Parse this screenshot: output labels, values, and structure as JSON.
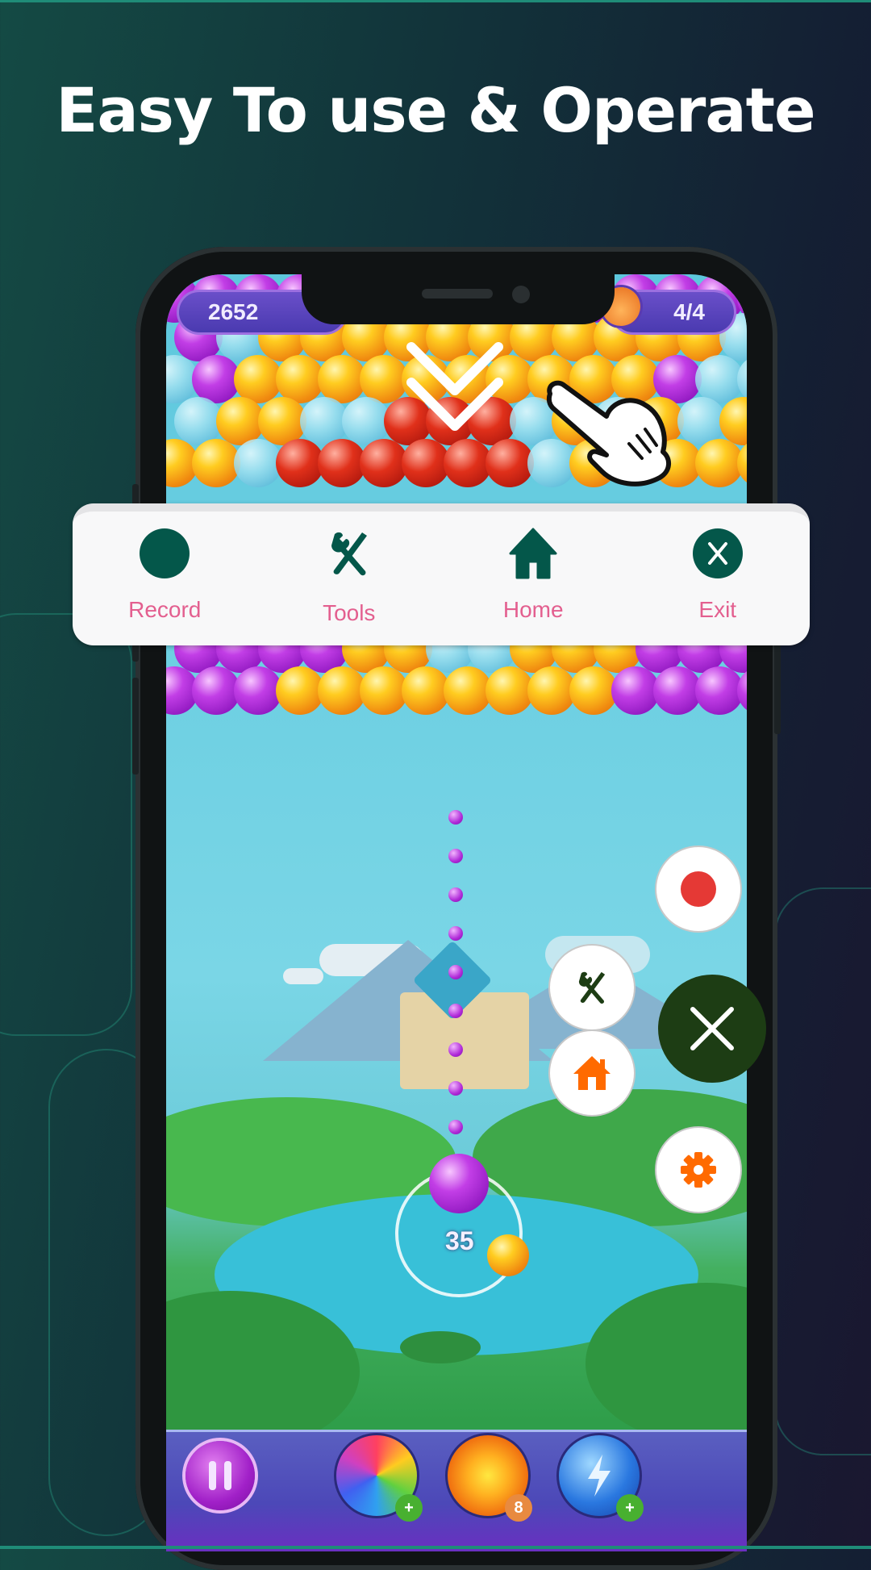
{
  "headline": "Easy To use & Operate",
  "game": {
    "score": "2652",
    "progress": "4/4",
    "shots_remaining": "35",
    "boosters": [
      {
        "name": "rainbow-booster",
        "badge": "+"
      },
      {
        "name": "fireball-booster",
        "badge": "8"
      },
      {
        "name": "lightning-booster",
        "badge": "+"
      }
    ],
    "pause_icon": "pause-icon"
  },
  "toolbar": {
    "items": [
      {
        "label": "Record",
        "icon": "record-icon"
      },
      {
        "label": "Tools",
        "icon": "tools-icon"
      },
      {
        "label": "Home",
        "icon": "home-icon"
      },
      {
        "label": "Exit",
        "icon": "exit-icon"
      }
    ],
    "icon_color": "#04574a",
    "label_color": "#e35f8f"
  },
  "floating_menu": {
    "buttons": [
      {
        "name": "record",
        "icon": "record-dot-icon",
        "color": "#e53935"
      },
      {
        "name": "tools",
        "icon": "tools-icon",
        "color": "#1d3d14"
      },
      {
        "name": "home",
        "icon": "home-icon",
        "color": "#ff6a00"
      },
      {
        "name": "close",
        "icon": "close-icon",
        "color": "#1d3d14"
      },
      {
        "name": "settings",
        "icon": "gear-icon",
        "color": "#ff6a00"
      }
    ]
  },
  "gesture_hint": {
    "icon": "double-chevron-down-icon",
    "hand": "pointing-hand-icon"
  }
}
